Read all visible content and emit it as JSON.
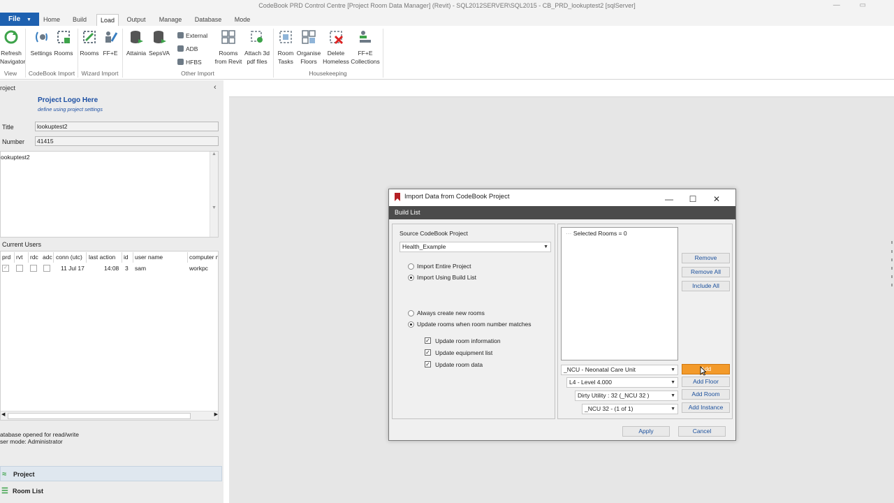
{
  "window": {
    "title": "CodeBook PRD Control Centre [Project Room Data Manager] (Revit) - SQL2012SERVER\\SQL2015 - CB_PRD_lookuptest2 [sqlServer]"
  },
  "tabs": {
    "file": "File",
    "home": "Home",
    "build": "Build",
    "load": "Load",
    "output": "Output",
    "manage": "Manage",
    "database": "Database",
    "mode": "Mode"
  },
  "ribbon": {
    "refresh": "Refresh",
    "navigator": "Navigator",
    "settings": "Settings",
    "rooms1": "Rooms",
    "rooms2": "Rooms",
    "ffe": "FF+E",
    "attainia": "Attainia",
    "sepsva": "SepsVA",
    "external": "External",
    "adb": "ADB",
    "hfbs": "HFBS",
    "rooms_from_l1": "Rooms",
    "rooms_from_l2": "from Revit",
    "attach_l1": "Attach 3d",
    "attach_l2": "pdf files",
    "room_tasks_l1": "Room",
    "room_tasks_l2": "Tasks",
    "organise_l1": "Organise",
    "organise_l2": "Floors",
    "delete_l1": "Delete",
    "delete_l2": "Homeless",
    "ffe_coll_l1": "FF+E",
    "ffe_coll_l2": "Collections",
    "group_view": "View",
    "group_codebook_import": "CodeBook Import",
    "group_wizard_import": "Wizard Import",
    "group_other_import": "Other Import",
    "group_housekeeping": "Housekeeping"
  },
  "project_panel": {
    "header": "roject",
    "logo_title": "Project Logo Here",
    "logo_sub": "define using project settings",
    "title_label": "Title",
    "title_value": "lookuptest2",
    "number_label": "Number",
    "number_value": "41415",
    "notes_text": "ookuptest2",
    "current_users_label": "Current Users",
    "columns": [
      "prd",
      "rvt",
      "rdc",
      "adc",
      "conn (utc)",
      "last action",
      "id",
      "user name",
      "computer n"
    ],
    "row": {
      "conn": "11 Jul 17",
      "last_action": "14:08",
      "id": "3",
      "user_name": "sam",
      "computer": "workpc"
    },
    "status_line1": "atabase opened for read/write",
    "status_line2": "ser mode: Administrator",
    "nav_project": "Project",
    "nav_room_list": "Room List"
  },
  "dialog": {
    "title": "Import Data from CodeBook Project",
    "band": "Build List",
    "source_label": "Source CodeBook Project",
    "source_value": "Health_Example",
    "import_entire": "Import Entire Project",
    "import_build_list": "Import Using Build List",
    "always_create": "Always create new rooms",
    "update_rooms": "Update rooms when room number matches",
    "update_info": "Update room information",
    "update_equipment": "Update equipment list",
    "update_data": "Update room data",
    "selected_rooms": "Selected Rooms = 0",
    "remove": "Remove",
    "remove_all": "Remove All",
    "include_all": "Include All",
    "dept_value": "_NCU - Neonatal Care Unit",
    "level_value": "L4 - Level 4.000",
    "room_value": "Dirty Utility : 32    (_NCU 32 )",
    "instance_value": "_NCU 32 -   (1 of 1)",
    "add": "Add",
    "add_floor": "Add Floor",
    "add_room": "Add Room",
    "add_instance": "Add Instance",
    "apply": "Apply",
    "cancel": "Cancel"
  },
  "colors": {
    "file_tab": "#1e61b0",
    "accent_orange": "#f39a2a",
    "band": "#4b4b4b",
    "link_blue": "#1c4fa3"
  }
}
